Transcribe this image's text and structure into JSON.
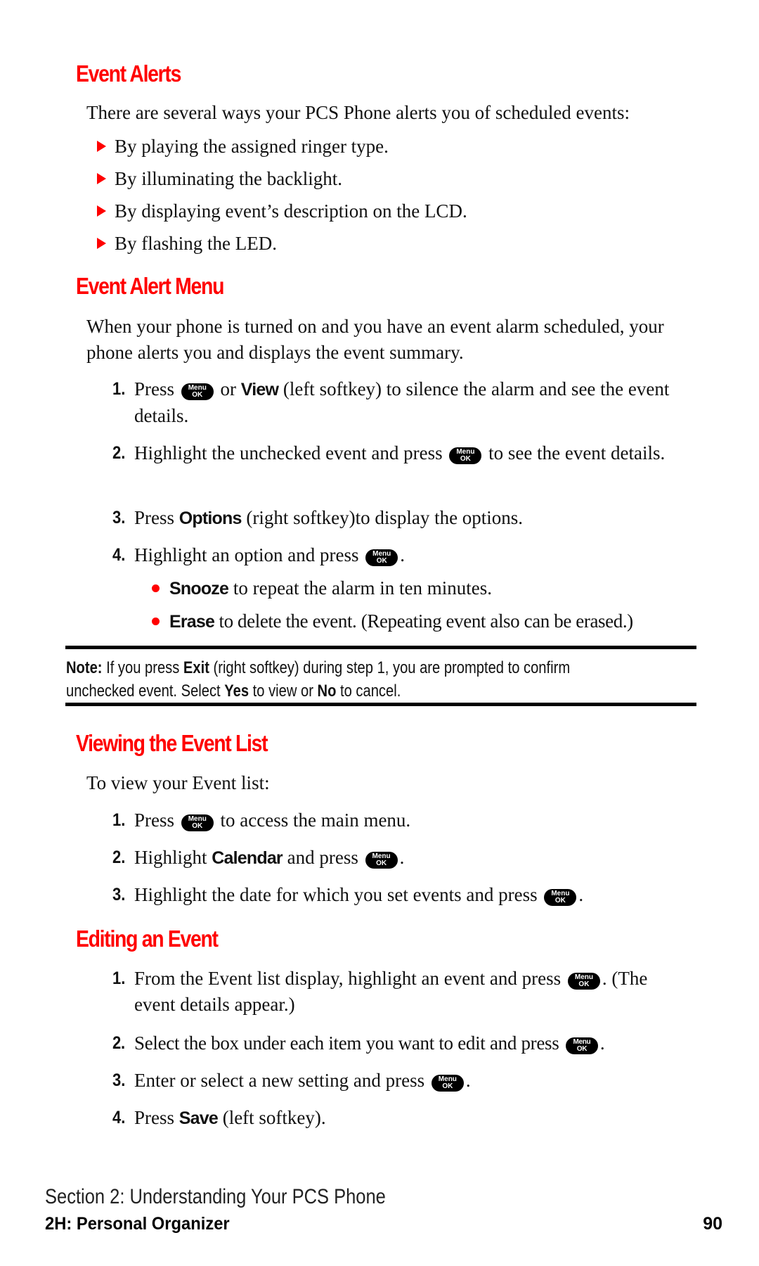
{
  "accent_color": "#ff0000",
  "key_icon": {
    "top": "Menu",
    "bottom": "OK"
  },
  "event_alerts": {
    "title": "Event Alerts",
    "intro": "There are several ways your PCS Phone alerts you of scheduled events:",
    "bullets": [
      "By playing the assigned ringer type.",
      "By illuminating the backlight.",
      "By displaying event’s description on the LCD.",
      "By flashing the LED."
    ]
  },
  "event_alert_menu": {
    "title": "Event Alert Menu",
    "intro": "When your phone is turned on and you have an event alarm scheduled, your phone alerts you and displays the event summary.",
    "steps": [
      {
        "num": "1.",
        "a": "Press",
        "b": "or",
        "bold": "View",
        "c": "(left softkey) to silence the alarm and see the event details."
      },
      {
        "num": "2.",
        "a": "Highlight the unchecked event and press",
        "c": "to see the event details."
      },
      {
        "num": "3.",
        "a": "Press",
        "bold": "Options",
        "c": "(right softkey)to display the options."
      },
      {
        "num": "4.",
        "a": "Highlight an option and press",
        "c": "."
      }
    ],
    "options": [
      {
        "bold": "Snooze",
        "text": "to repeat the alarm in ten minutes."
      },
      {
        "bold": "Erase",
        "text": "to delete the event. (Repeating event also can be erased.)"
      }
    ]
  },
  "note": {
    "label": "Note:",
    "t1": "If you press",
    "exit": "Exit",
    "t2": "(right softkey) during step 1, you are prompted to confirm unchecked event. Select",
    "yes": "Yes",
    "t3": "to view or",
    "no": "No",
    "t4": "to cancel."
  },
  "viewing": {
    "title": "Viewing the Event List",
    "intro": "To view your Event list:",
    "steps": [
      {
        "num": "1.",
        "a": "Press",
        "c": "to access the main menu."
      },
      {
        "num": "2.",
        "a": "Highlight",
        "bold": "Calendar",
        "b": "and press",
        "c": "."
      },
      {
        "num": "3.",
        "a": "Highlight the date for which you set events and press",
        "c": "."
      }
    ]
  },
  "editing": {
    "title": "Editing an Event",
    "steps": [
      {
        "num": "1.",
        "a": "From the Event list display, highlight an event and press",
        "c": ". (The event details appear.)"
      },
      {
        "num": "2.",
        "a": "Select the box under each item you want to edit and press",
        "c": "."
      },
      {
        "num": "3.",
        "a": "Enter or select a new setting and press",
        "c": "."
      },
      {
        "num": "4.",
        "a": "Press",
        "bold": "Save",
        "c": "(left softkey)."
      }
    ]
  },
  "footer": {
    "section": "Section 2: Understanding Your PCS Phone",
    "chapter": "2H: Personal Organizer",
    "page": "90"
  }
}
